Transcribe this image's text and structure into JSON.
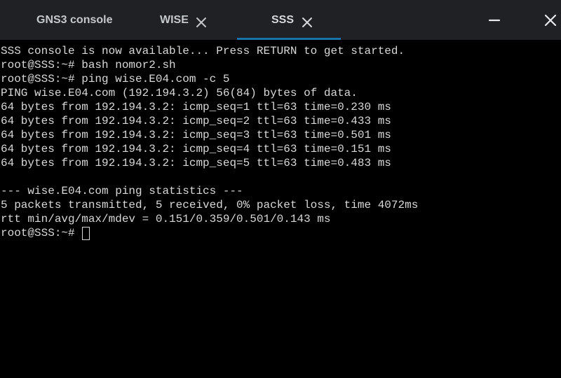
{
  "tabs": [
    {
      "label": "GNS3 console",
      "closable": false,
      "active": false
    },
    {
      "label": "WISE",
      "closable": true,
      "active": false
    },
    {
      "label": "SSS",
      "closable": true,
      "active": true
    }
  ],
  "window_controls": {
    "minimize_icon": "minimize-icon",
    "close_icon": "close-icon"
  },
  "colors": {
    "tabbar_bg": "#202124",
    "tab_text": "#c4c7cb",
    "active_underline": "#1a73a8",
    "terminal_bg": "#000000",
    "terminal_fg": "#d8d8d8"
  },
  "terminal": {
    "lines": [
      "SSS console is now available... Press RETURN to get started.",
      "root@SSS:~# bash nomor2.sh",
      "root@SSS:~# ping wise.E04.com -c 5",
      "PING wise.E04.com (192.194.3.2) 56(84) bytes of data.",
      "64 bytes from 192.194.3.2: icmp_seq=1 ttl=63 time=0.230 ms",
      "64 bytes from 192.194.3.2: icmp_seq=2 ttl=63 time=0.433 ms",
      "64 bytes from 192.194.3.2: icmp_seq=3 ttl=63 time=0.501 ms",
      "64 bytes from 192.194.3.2: icmp_seq=4 ttl=63 time=0.151 ms",
      "64 bytes from 192.194.3.2: icmp_seq=5 ttl=63 time=0.483 ms",
      "",
      "--- wise.E04.com ping statistics ---",
      "5 packets transmitted, 5 received, 0% packet loss, time 4072ms",
      "rtt min/avg/max/mdev = 0.151/0.359/0.501/0.143 ms"
    ],
    "prompt": "root@SSS:~# "
  }
}
